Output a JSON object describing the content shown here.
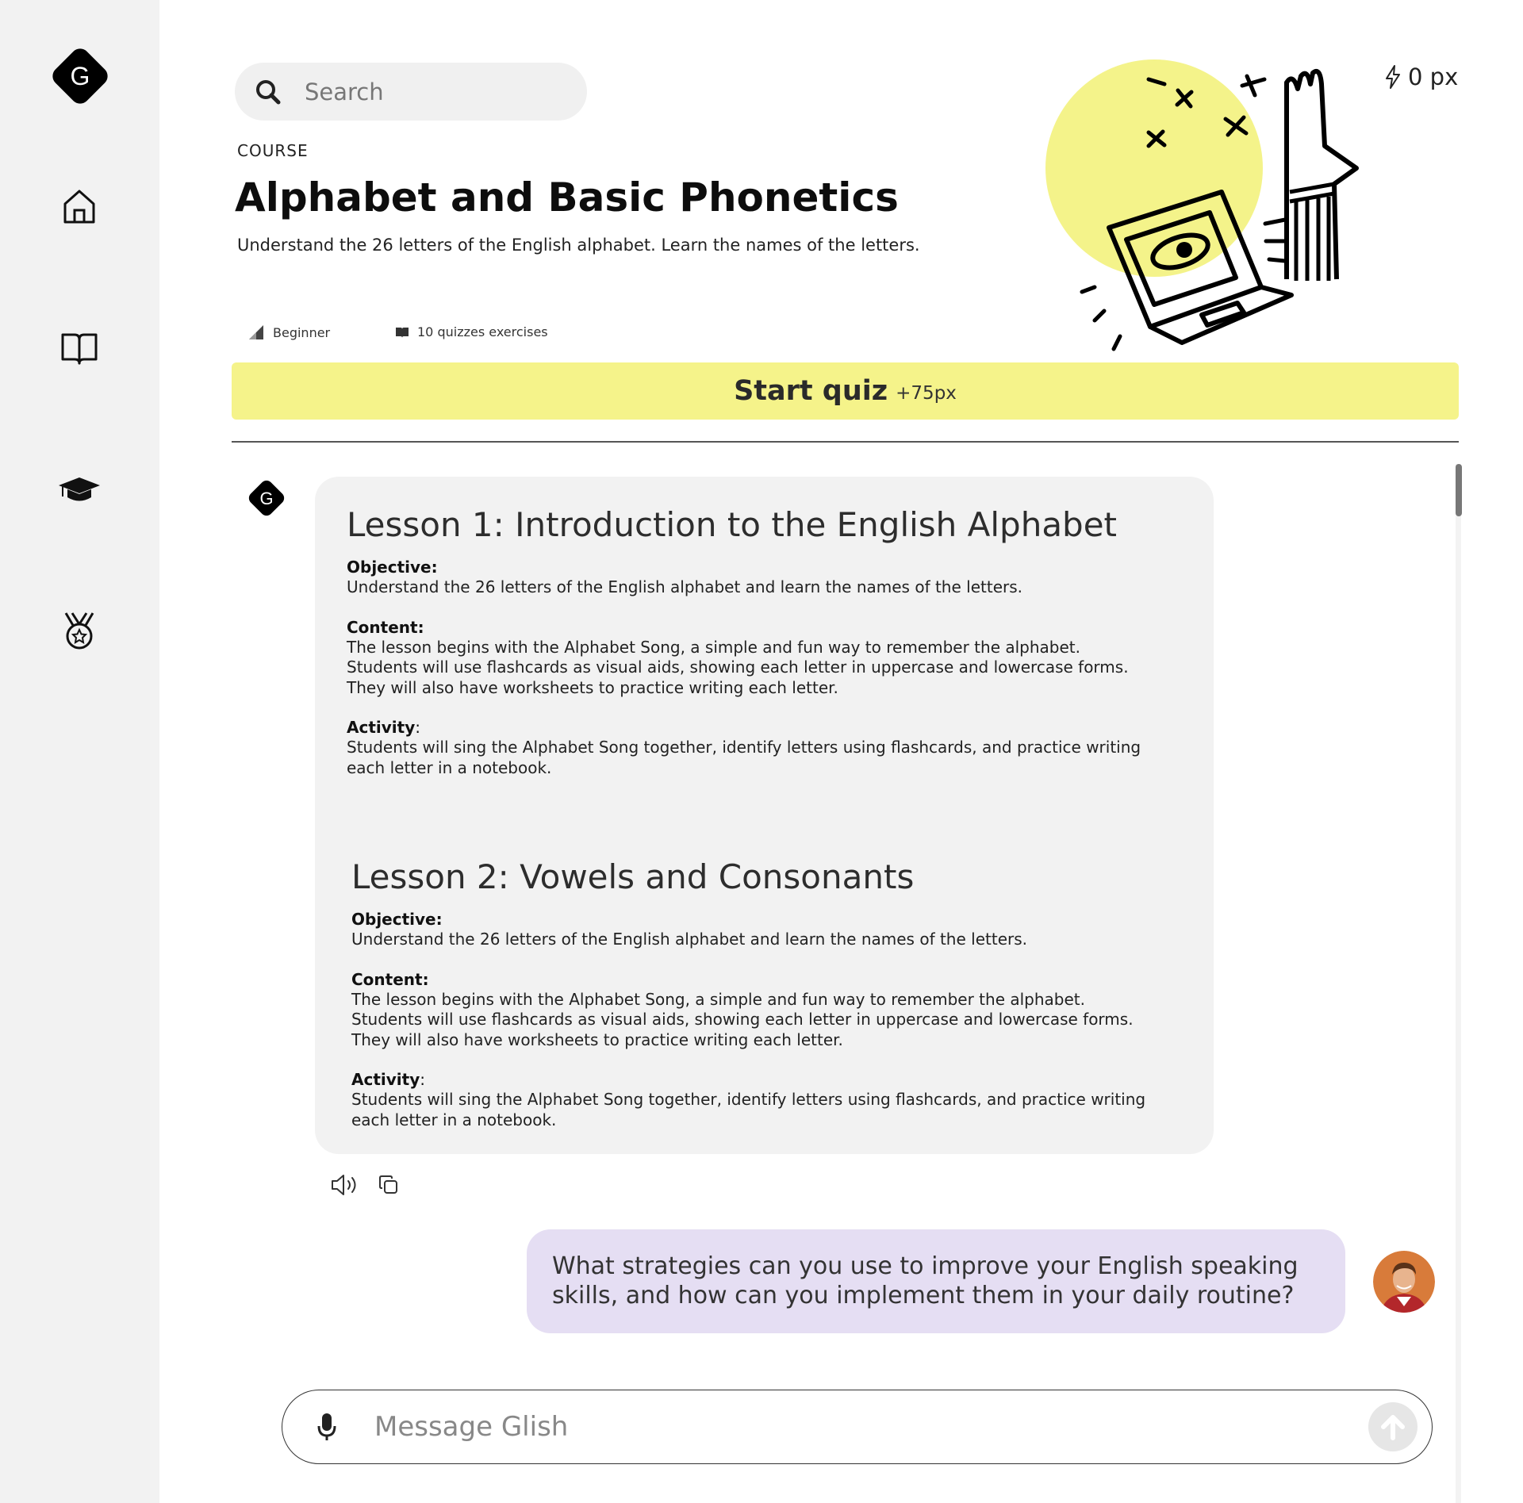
{
  "sidebar": {
    "logo_letter": "G",
    "items": [
      {
        "name": "home-icon"
      },
      {
        "name": "book-icon"
      },
      {
        "name": "graduation-cap-icon"
      },
      {
        "name": "medal-icon"
      }
    ]
  },
  "search": {
    "placeholder": "Search"
  },
  "header": {
    "points_value": "0 px",
    "eyebrow": "COURSE",
    "title": "Alphabet and Basic Phonetics",
    "subtitle": "Understand the 26 letters of the English alphabet. Learn the names of the letters.",
    "level": "Beginner",
    "quizzes": "10 quizzes exercises"
  },
  "quiz_button": {
    "label": "Start quiz",
    "bonus": "+75px",
    "color": "#f5f38a"
  },
  "lessons": [
    {
      "title": "Lesson 1: Introduction to the English Alphabet",
      "objective_label": "Objective:",
      "objective": "Understand the 26 letters of the English alphabet and learn the names of the letters.",
      "content_label": "Content:",
      "content": [
        "The lesson begins with the Alphabet Song, a simple and fun way to remember the alphabet.",
        "Students will use flashcards as visual aids, showing each letter in uppercase and lowercase forms.",
        "They will also have worksheets to practice writing each letter."
      ],
      "activity_label": "Activity",
      "activity": [
        "Students will sing the Alphabet Song together, identify letters using flashcards, and practice writing",
        "each letter in a notebook."
      ]
    },
    {
      "title": "Lesson 2: Vowels and Consonants",
      "objective_label": "Objective:",
      "objective": "Understand the 26 letters of the English alphabet and learn the names of the letters.",
      "content_label": "Content:",
      "content": [
        "The lesson begins with the Alphabet Song, a simple and fun way to remember the alphabet.",
        "Students will use flashcards as visual aids, showing each letter in uppercase and lowercase forms.",
        "They will also have worksheets to practice writing each letter."
      ],
      "activity_label": "Activity",
      "activity": [
        "Students will sing the Alphabet Song together, identify letters using flashcards, and practice writing",
        "each letter in a notebook."
      ]
    }
  ],
  "message_actions": [
    {
      "name": "speaker-icon"
    },
    {
      "name": "copy-icon"
    }
  ],
  "user_message": {
    "lines": [
      "What strategies can you use to improve your English speaking",
      "skills, and how can you implement them in your daily routine?"
    ],
    "bubble_color": "#e5def3"
  },
  "composer": {
    "placeholder": "Message Glish"
  }
}
